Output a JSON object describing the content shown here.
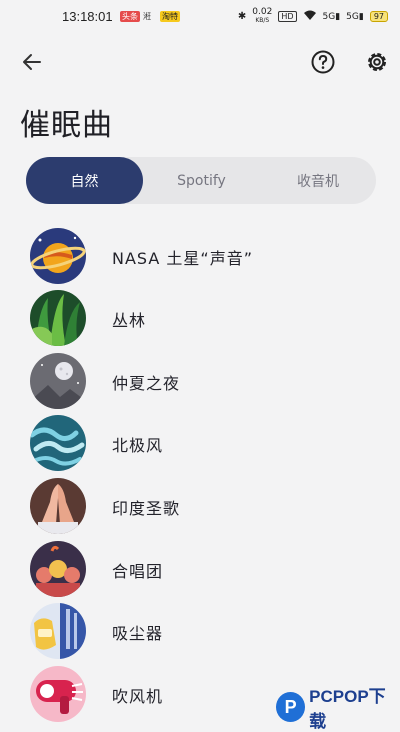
{
  "status_bar": {
    "time": "13:18:01",
    "badge_red": "头条",
    "badge_mi": "㳹",
    "badge_yellow": "淘特",
    "speed_value": "0.02",
    "speed_unit": "KB/S",
    "hd": "HD",
    "signal1": "5G",
    "signal2": "5G",
    "battery": "97"
  },
  "header": {
    "back_icon": "arrow-left-icon",
    "help_icon": "question-circle-icon",
    "settings_icon": "gear-icon"
  },
  "page": {
    "title": "催眠曲"
  },
  "tabs": [
    {
      "label": "自然",
      "active": true
    },
    {
      "label": "Spotify",
      "active": false
    },
    {
      "label": "收音机",
      "active": false
    }
  ],
  "items": [
    {
      "label": "NASA 土星“声音”"
    },
    {
      "label": "丛林"
    },
    {
      "label": "仲夏之夜"
    },
    {
      "label": "北极风"
    },
    {
      "label": "印度圣歌"
    },
    {
      "label": "合唱团"
    },
    {
      "label": "吸尘器"
    },
    {
      "label": "吹风机"
    }
  ],
  "watermark": {
    "text": "PCPOP下载",
    "logo": "P"
  }
}
